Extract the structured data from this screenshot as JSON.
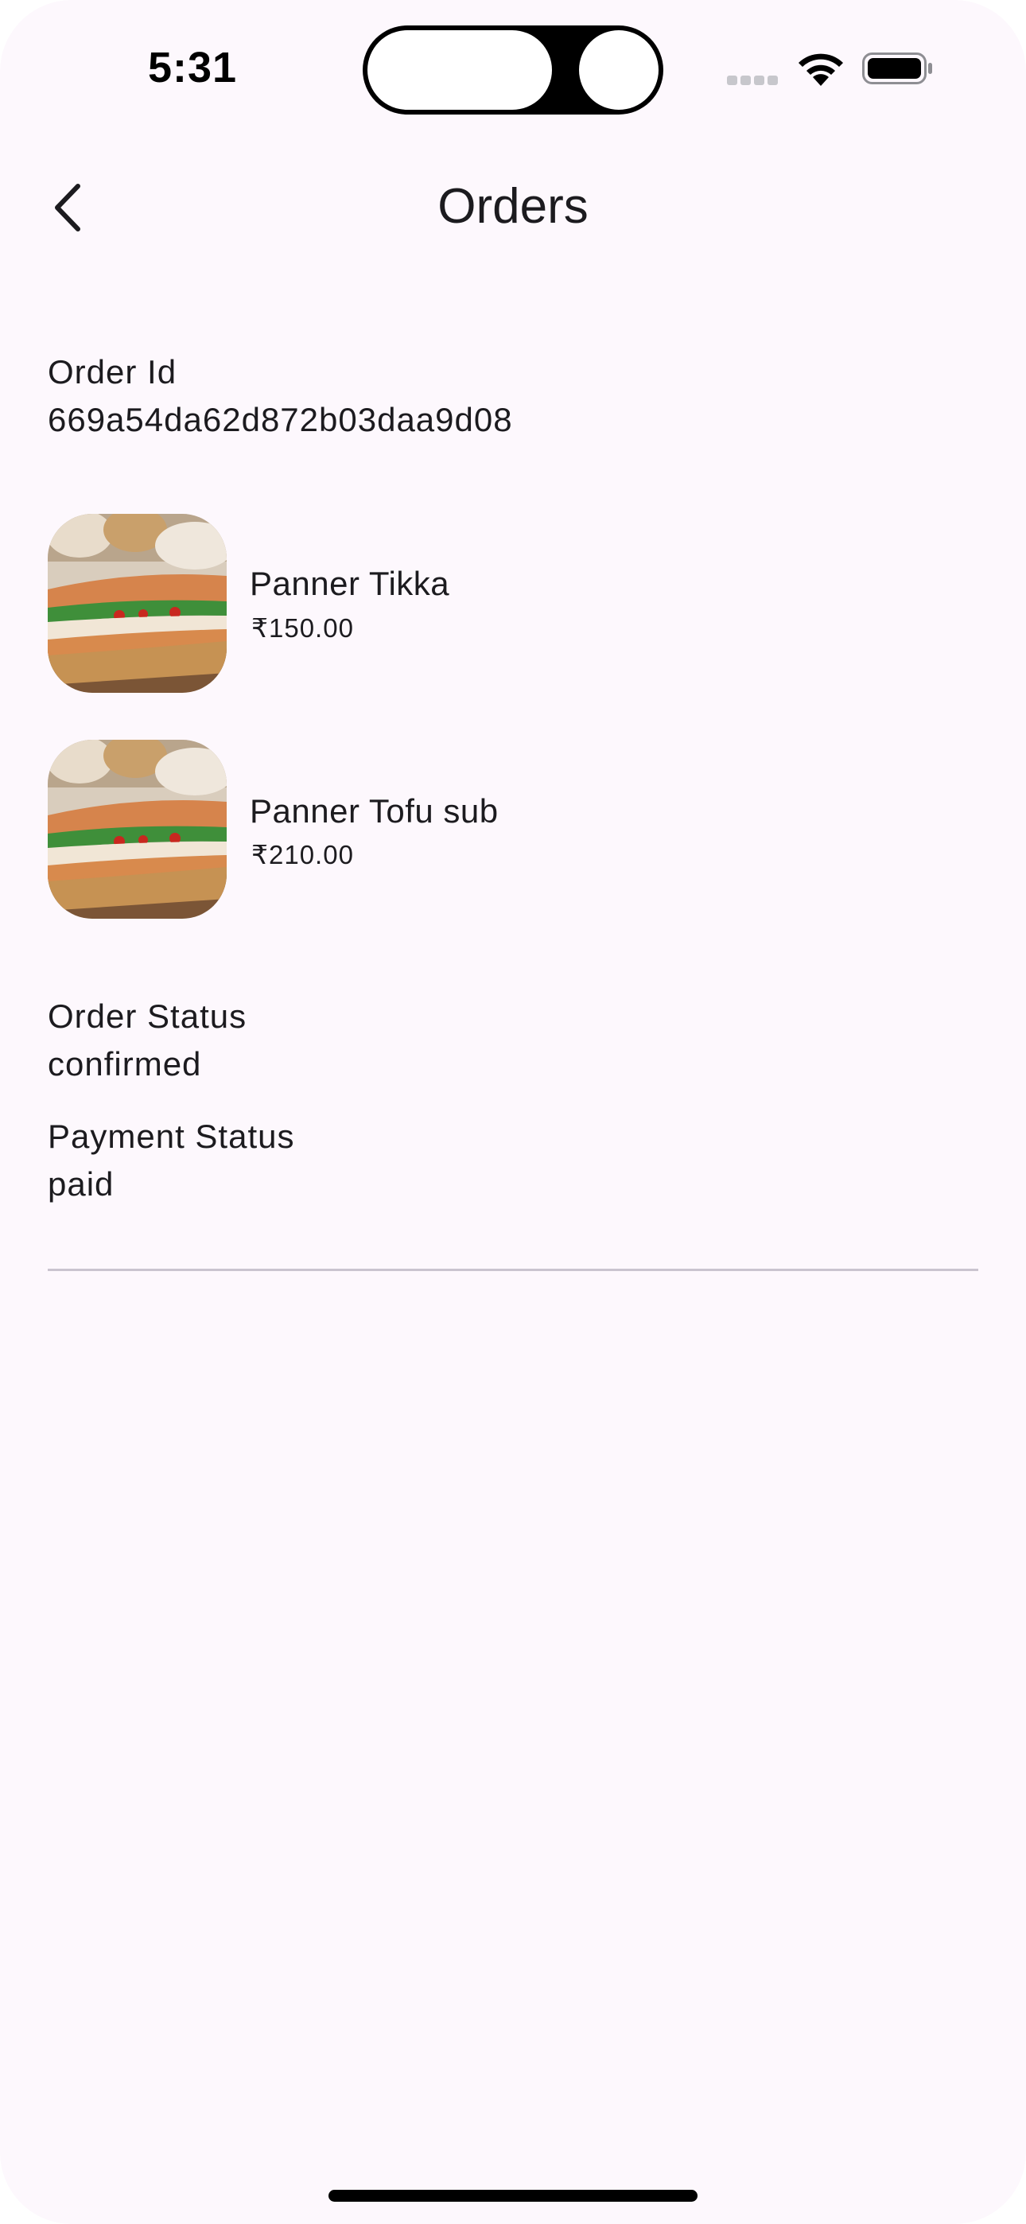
{
  "status_bar": {
    "time": "5:31",
    "signal_icon": "cellular-signal-icon",
    "wifi_icon": "wifi-icon",
    "battery_icon": "battery-icon"
  },
  "header": {
    "title": "Orders",
    "back_icon": "chevron-left-icon"
  },
  "order": {
    "id_label": "Order Id",
    "id_value": "669a54da62d872b03daa9d08",
    "items": [
      {
        "name": "Panner Tikka",
        "price": "₹150.00",
        "image": "sandwich-photo"
      },
      {
        "name": "Panner Tofu sub",
        "price": "₹210.00",
        "image": "sandwich-photo"
      }
    ],
    "order_status_label": "Order Status",
    "order_status_value": "confirmed",
    "payment_status_label": "Payment Status",
    "payment_status_value": "paid"
  },
  "colors": {
    "background": "#fdf8fd",
    "text": "#1c1b1f",
    "divider": "#cac4cf"
  }
}
